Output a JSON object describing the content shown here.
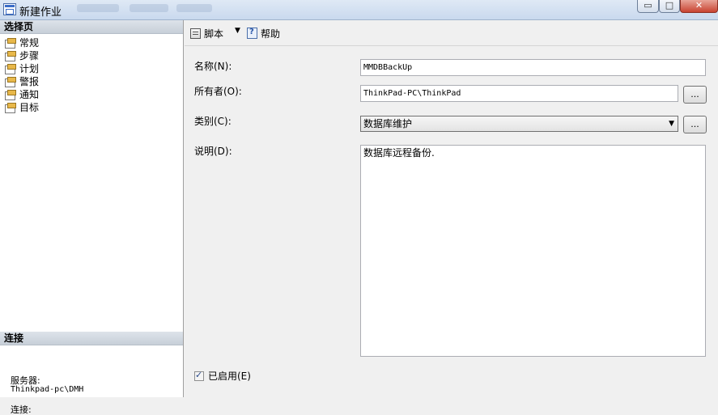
{
  "window": {
    "title": "新建作业",
    "minimize_glyph": "▭",
    "maximize_glyph": "□",
    "close_glyph": "✕"
  },
  "left": {
    "select_page_header": "选择页",
    "pages": [
      {
        "label": "常规",
        "icon": "page-icon"
      },
      {
        "label": "步骤",
        "icon": "page-icon"
      },
      {
        "label": "计划",
        "icon": "page-icon"
      },
      {
        "label": "警报",
        "icon": "page-icon"
      },
      {
        "label": "通知",
        "icon": "page-icon"
      },
      {
        "label": "目标",
        "icon": "page-icon"
      }
    ],
    "connection_header": "连接",
    "server_label": "服务器:",
    "server_value": "Thinkpad-pc\\DMH",
    "connection_label": "连接:"
  },
  "toolbar": {
    "script_label": "脚本",
    "dropdown_glyph": "▼",
    "help_label": "帮助"
  },
  "form": {
    "name_label": "名称(N):",
    "name_value": "MMDBBackUp",
    "owner_label": "所有者(O):",
    "owner_value": "ThinkPad-PC\\ThinkPad",
    "owner_browse": "...",
    "category_label": "类别(C):",
    "category_value": "数据库维护",
    "category_arrow": "▼",
    "category_browse": "...",
    "description_label": "说明(D):",
    "description_value": "数据库远程备份.",
    "enabled_label": "已启用(E)",
    "enabled_checked": true
  }
}
